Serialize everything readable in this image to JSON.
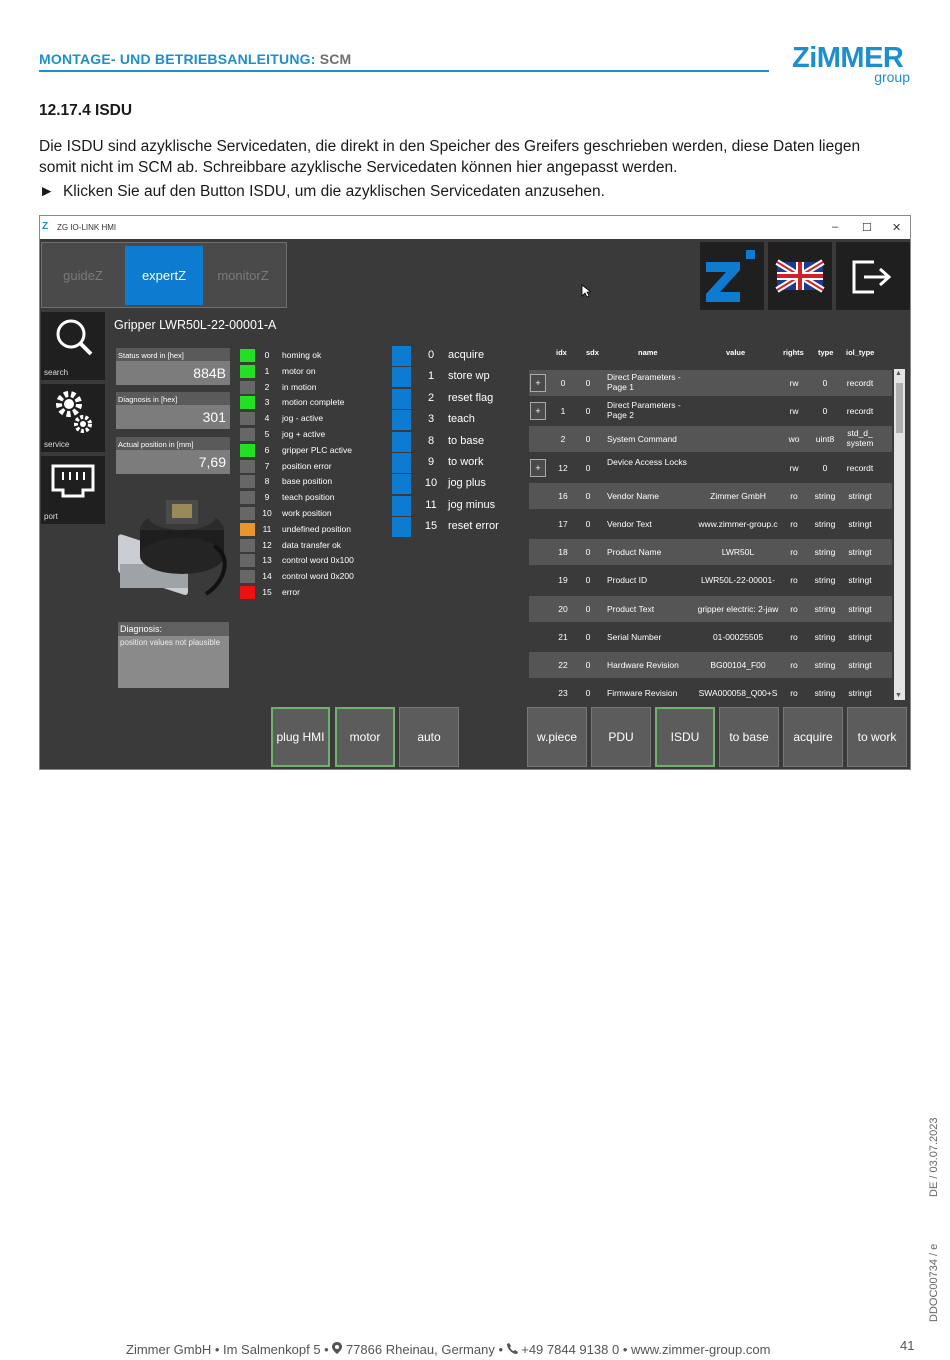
{
  "header": {
    "title_part1": "MONTAGE- UND BETRIEBSANLEITUNG:",
    "title_part2": "SCM"
  },
  "logo": {
    "word": "ZiMMER",
    "group": "group"
  },
  "section": {
    "heading": "12.17.4 ISDU"
  },
  "body": {
    "paragraph": "Die ISDU sind azyklische Servicedaten, die direkt in den Speicher des Greifers geschrieben werden, diese Daten liegen somit nicht im SCM ab. Schreibbare azyklische Servicedaten können hier angepasst werden.",
    "bullet_marker": "►",
    "bullet": "Klicken Sie auf den Button ISDU, um die azyklischen Servicedaten anzusehen."
  },
  "app": {
    "window_title": "ZG IO-LINK HMI",
    "window_controls": [
      "–",
      "☐",
      "✕"
    ],
    "tabs": [
      "guideZ",
      "expertZ",
      "monitorZ"
    ],
    "active_tab": "expertZ",
    "side_items": [
      "search",
      "service",
      "port"
    ],
    "gripper_title": "Gripper LWR50L-22-00001-A",
    "stats": [
      {
        "label": "Status word in [hex]",
        "value": "884B"
      },
      {
        "label": "Diagnosis in [hex]",
        "value": "301"
      },
      {
        "label": "Actual position in [mm]",
        "value": "7,69"
      }
    ],
    "diagnosis": {
      "label": "Diagnosis:",
      "text": "position values not plausible"
    },
    "status_bits": [
      {
        "num": "0",
        "name": "homing ok",
        "color": "#22e022"
      },
      {
        "num": "1",
        "name": "motor on",
        "color": "#22e022"
      },
      {
        "num": "2",
        "name": "in motion",
        "color": "#676767"
      },
      {
        "num": "3",
        "name": "motion complete",
        "color": "#22e022"
      },
      {
        "num": "4",
        "name": "jog - active",
        "color": "#676767"
      },
      {
        "num": "5",
        "name": "jog + active",
        "color": "#676767"
      },
      {
        "num": "6",
        "name": "gripper PLC active",
        "color": "#22e022"
      },
      {
        "num": "7",
        "name": "position error",
        "color": "#676767"
      },
      {
        "num": "8",
        "name": "base position",
        "color": "#676767"
      },
      {
        "num": "9",
        "name": "teach position",
        "color": "#676767"
      },
      {
        "num": "10",
        "name": "work position",
        "color": "#676767"
      },
      {
        "num": "11",
        "name": "undefined position",
        "color": "#e8952a"
      },
      {
        "num": "12",
        "name": "data transfer ok",
        "color": "#676767"
      },
      {
        "num": "13",
        "name": "control word 0x100",
        "color": "#676767"
      },
      {
        "num": "14",
        "name": "control word 0x200",
        "color": "#676767"
      },
      {
        "num": "15",
        "name": "error",
        "color": "#ee1111"
      }
    ],
    "commands": [
      {
        "num": "0",
        "name": "acquire"
      },
      {
        "num": "1",
        "name": "store wp"
      },
      {
        "num": "2",
        "name": "reset flag"
      },
      {
        "num": "3",
        "name": "teach"
      },
      {
        "num": "8",
        "name": "to base"
      },
      {
        "num": "9",
        "name": "to work"
      },
      {
        "num": "10",
        "name": "jog plus"
      },
      {
        "num": "11",
        "name": "jog minus"
      },
      {
        "num": "15",
        "name": "reset error"
      }
    ],
    "isdu_headers": [
      "idx",
      "sdx",
      "name",
      "value",
      "rights",
      "type",
      "iol_type"
    ],
    "isdu_rows": [
      {
        "plus": "+",
        "idx": "0",
        "sdx": "0",
        "name": "Direct Parameters - Page 1",
        "value": "",
        "rights": "rw",
        "type": "0",
        "iol_type": "recordt"
      },
      {
        "plus": "+",
        "idx": "1",
        "sdx": "0",
        "name": "Direct Parameters - Page 2",
        "value": "",
        "rights": "rw",
        "type": "0",
        "iol_type": "recordt"
      },
      {
        "plus": "",
        "idx": "2",
        "sdx": "0",
        "name": "System Command",
        "value": "",
        "rights": "wo",
        "type": "uint8",
        "iol_type": "std_d_ system"
      },
      {
        "plus": "+",
        "idx": "12",
        "sdx": "0",
        "name": "Device Access Locks",
        "value": "",
        "rights": "rw",
        "type": "0",
        "iol_type": "recordt"
      },
      {
        "plus": "",
        "idx": "16",
        "sdx": "0",
        "name": "Vendor Name",
        "value": "Zimmer GmbH",
        "rights": "ro",
        "type": "string",
        "iol_type": "stringt"
      },
      {
        "plus": "",
        "idx": "17",
        "sdx": "0",
        "name": "Vendor Text",
        "value": "www.zimmer-group.c",
        "rights": "ro",
        "type": "string",
        "iol_type": "stringt"
      },
      {
        "plus": "",
        "idx": "18",
        "sdx": "0",
        "name": "Product Name",
        "value": "LWR50L",
        "rights": "ro",
        "type": "string",
        "iol_type": "stringt"
      },
      {
        "plus": "",
        "idx": "19",
        "sdx": "0",
        "name": "Product ID",
        "value": "LWR50L-22-00001-",
        "rights": "ro",
        "type": "string",
        "iol_type": "stringt"
      },
      {
        "plus": "",
        "idx": "20",
        "sdx": "0",
        "name": "Product Text",
        "value": "gripper electric: 2-jaw",
        "rights": "ro",
        "type": "string",
        "iol_type": "stringt"
      },
      {
        "plus": "",
        "idx": "21",
        "sdx": "0",
        "name": "Serial Number",
        "value": "01-00025505",
        "rights": "ro",
        "type": "string",
        "iol_type": "stringt"
      },
      {
        "plus": "",
        "idx": "22",
        "sdx": "0",
        "name": "Hardware Revision",
        "value": "BG00104_F00",
        "rights": "ro",
        "type": "string",
        "iol_type": "stringt"
      },
      {
        "plus": "",
        "idx": "23",
        "sdx": "0",
        "name": "Firmware Revision",
        "value": "SWA000058_Q00+S",
        "rights": "ro",
        "type": "string",
        "iol_type": "stringt"
      }
    ],
    "bottom_buttons": [
      "plug HMI",
      "motor",
      "auto",
      "w.piece",
      "PDU",
      "ISDU",
      "to base",
      "acquire",
      "to work"
    ],
    "green_buttons": [
      "plug HMI",
      "motor",
      "ISDU"
    ]
  },
  "side_text": {
    "date": "DE / 03.07.2023",
    "doc": "DDOC00734 / e"
  },
  "footer": {
    "company": "Zimmer GmbH",
    "street": "Im Salmenkopf 5",
    "city": "77866 Rheinau, Germany",
    "phone": "+49 7844 9138 0",
    "web": "www.zimmer-group.com",
    "page": "41"
  }
}
